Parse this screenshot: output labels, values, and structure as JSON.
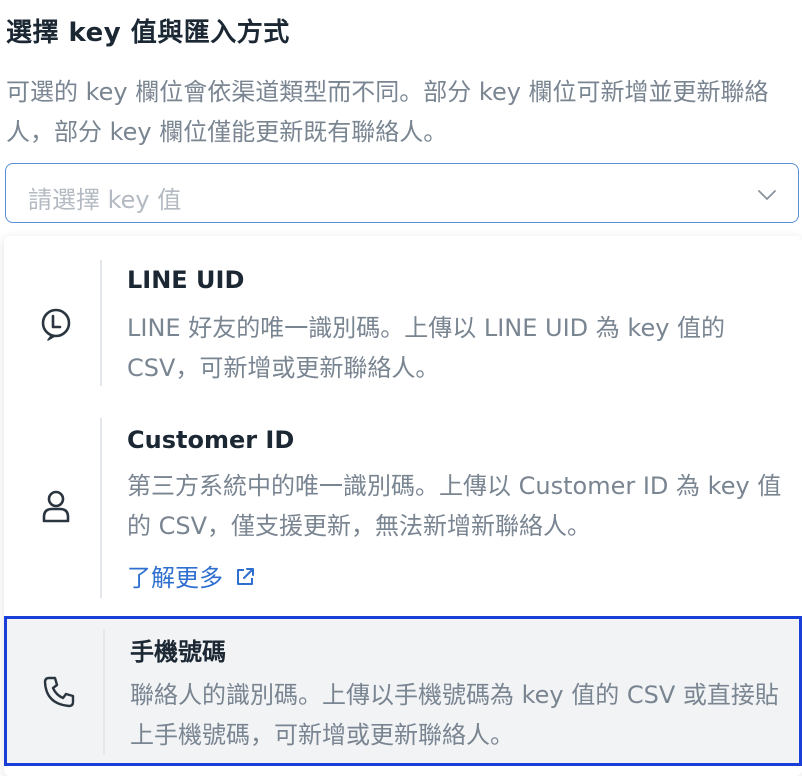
{
  "header": {
    "title": "選擇 key 值與匯入方式",
    "description": "可選的 key 欄位會依渠道類型而不同。部分 key 欄位可新增並更新聯絡人，部分 key 欄位僅能更新既有聯絡人。"
  },
  "select": {
    "placeholder": "請選擇 key 值",
    "icon": "chevron-down-icon"
  },
  "options": [
    {
      "title": "LINE UID",
      "description": "LINE 好友的唯一識別碼。上傳以 LINE UID 為 key 值的 CSV，可新增或更新聯絡人。",
      "icon": "line-icon"
    },
    {
      "title": "Customer ID",
      "description": "第三方系統中的唯一識別碼。上傳以 Customer ID 為 key 值的 CSV，僅支援更新，無法新增新聯絡人。",
      "icon": "user-icon",
      "link": "了解更多",
      "link_icon": "external-link-icon"
    },
    {
      "title": "手機號碼",
      "description": "聯絡人的識別碼。上傳以手機號碼為 key 值的 CSV 或直接貼上手機號碼，可新增或更新聯絡人。",
      "icon": "phone-icon",
      "selected": true
    }
  ],
  "colors": {
    "accent": "#2f6fcf",
    "selected_border": "#1a3fd9",
    "select_border": "#5a8fd6"
  }
}
